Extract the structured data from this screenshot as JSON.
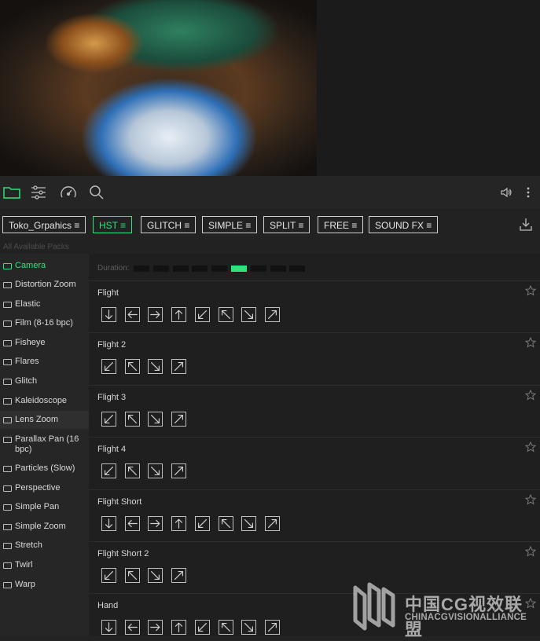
{
  "packs": [
    {
      "label": "Toko_Grpahics ≡",
      "active": false
    },
    {
      "label": "HST ≡",
      "active": true
    },
    {
      "label": "GLITCH ≡",
      "active": false
    },
    {
      "label": "SIMPLE ≡",
      "active": false
    },
    {
      "label": "SPLIT ≡",
      "active": false
    },
    {
      "label": "FREE ≡",
      "active": false
    },
    {
      "label": "SOUND FX ≡",
      "active": false
    }
  ],
  "packs_caption": "All Available Packs",
  "categories": [
    "Camera",
    "Distortion Zoom",
    "Elastic",
    "Film (8-16 bpc)",
    "Fisheye",
    "Flares",
    "Glitch",
    "Kaleidoscope",
    "Lens Zoom",
    "Parallax Pan (16 bpc)",
    "Particles (Slow)",
    "Perspective",
    "Simple Pan",
    "Simple Zoom",
    "Stretch",
    "Twirl",
    "Warp"
  ],
  "active_category": "Camera",
  "hovered_category": "Lens Zoom",
  "duration": {
    "label": "Duration:",
    "segments": 9,
    "selected_index": 5
  },
  "presets": [
    {
      "title": "Flight",
      "arrows": [
        "down-arrow",
        "left-arrow",
        "right-arrow",
        "up-arrow",
        "down-left-arrow",
        "up-left-arrow",
        "down-right-arrow",
        "up-right-arrow"
      ]
    },
    {
      "title": "Flight 2",
      "arrows": [
        "down-left-arrow",
        "up-left-arrow",
        "down-right-arrow",
        "up-right-arrow"
      ]
    },
    {
      "title": "Flight 3",
      "arrows": [
        "down-left-arrow",
        "up-left-arrow",
        "down-right-arrow",
        "up-right-arrow"
      ]
    },
    {
      "title": "Flight 4",
      "arrows": [
        "down-left-arrow",
        "up-left-arrow",
        "down-right-arrow",
        "up-right-arrow"
      ]
    },
    {
      "title": "Flight Short",
      "arrows": [
        "down-arrow",
        "left-arrow",
        "right-arrow",
        "up-arrow",
        "down-left-arrow",
        "up-left-arrow",
        "down-right-arrow",
        "up-right-arrow"
      ]
    },
    {
      "title": "Flight Short 2",
      "arrows": [
        "down-left-arrow",
        "up-left-arrow",
        "down-right-arrow",
        "up-right-arrow"
      ]
    },
    {
      "title": "Hand",
      "arrows": [
        "down-arrow",
        "left-arrow",
        "right-arrow",
        "up-arrow",
        "down-left-arrow",
        "up-left-arrow",
        "down-right-arrow",
        "up-right-arrow"
      ]
    }
  ],
  "watermark": {
    "cn": "中国CG视效联盟",
    "en": "CHINACGVISIONALLIANCE"
  },
  "colors": {
    "accent": "#2de37a",
    "bg": "#1f1f1f"
  }
}
